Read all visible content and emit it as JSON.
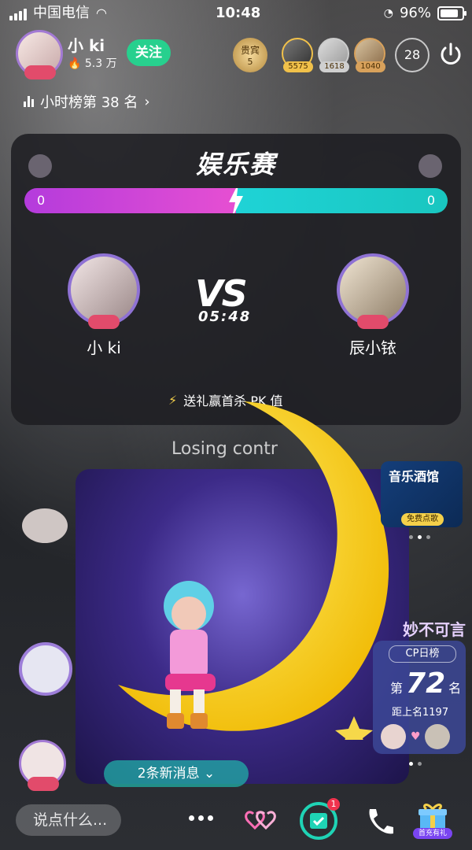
{
  "status_bar": {
    "carrier": "中国电信",
    "time": "10:48",
    "battery": "96%"
  },
  "host": {
    "name": "小 ki",
    "fans": "5.3 万",
    "follow_label": "关注"
  },
  "vip": {
    "label": "贵宾",
    "count": "5"
  },
  "top_viewers": [
    {
      "count": "5575"
    },
    {
      "count": "1618"
    },
    {
      "count": "1040"
    }
  ],
  "online_count": "28",
  "rank": {
    "text": "小时榜第 38 名"
  },
  "pk": {
    "title": "娱乐赛",
    "left_score": "0",
    "right_score": "0",
    "left_name": "小 ki",
    "right_name": "辰小铱",
    "vs": "VS",
    "timer": "05:48",
    "hint": "送礼赢首杀 PK 值",
    "colors": {
      "left": "#e64fd2",
      "right": "#19c6c0"
    }
  },
  "overlay": {
    "losing_text": "Losing contr"
  },
  "music_card": {
    "title": "音乐酒馆",
    "button": "免费点歌"
  },
  "cp": {
    "title": "妙不可言",
    "tag": "CP日榜",
    "prefix": "第",
    "rank": "72",
    "suffix": "名",
    "gap": "距上名1197"
  },
  "chat": {
    "new_messages": "2条新消息",
    "placeholder": "说点什么..."
  },
  "calendar_badge": "1",
  "gift_label": "首充有礼"
}
